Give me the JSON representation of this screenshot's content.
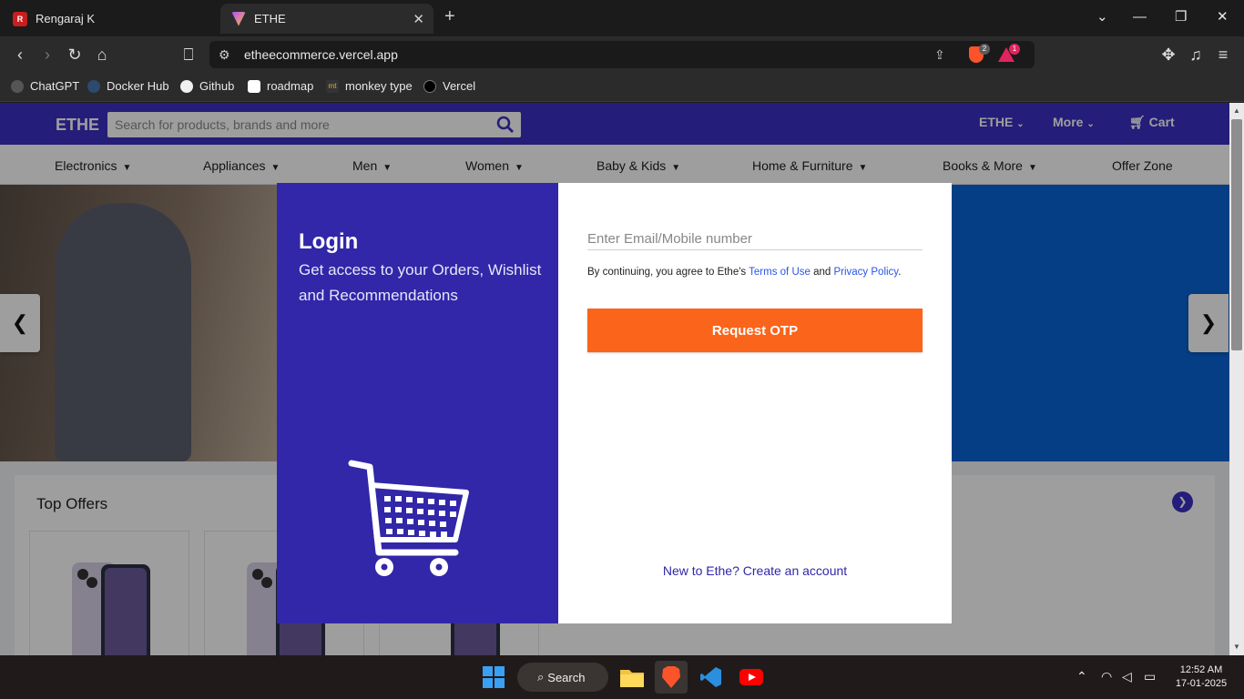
{
  "browser": {
    "tabs": [
      {
        "title": "Rengaraj K",
        "favicon": "R"
      },
      {
        "title": "ETHE"
      }
    ],
    "url": "etheecommerce.vercel.app",
    "shield_count": "2",
    "rewards_count": "1",
    "bookmarks": [
      {
        "label": "ChatGPT"
      },
      {
        "label": "Docker Hub"
      },
      {
        "label": "Github"
      },
      {
        "label": "roadmap"
      },
      {
        "label": "monkey type",
        "icon_text": "mt"
      },
      {
        "label": "Vercel"
      }
    ]
  },
  "site": {
    "logo": "ETHE",
    "search_placeholder": "Search for products, brands and more",
    "header_links": {
      "account": "ETHE",
      "more": "More",
      "cart": "Cart"
    },
    "categories": [
      "Electronics",
      "Appliances",
      "Men",
      "Women",
      "Baby & Kids",
      "Home & Furniture",
      "Books & More",
      "Offer Zone"
    ],
    "top_offers_title": "Top Offers"
  },
  "login_modal": {
    "title": "Login",
    "subtitle": "Get access to your Orders, Wishlist and Recommendations",
    "email_placeholder": "Enter Email/Mobile number",
    "terms_prefix": "By continuing, you agree to Ethe's ",
    "terms_link": "Terms of Use",
    "terms_and": " and ",
    "privacy_link": "Privacy Policy",
    "terms_suffix": ".",
    "otp_button": "Request OTP",
    "signup_link": "New to Ethe? Create an account",
    "close_icon": "×"
  },
  "taskbar": {
    "search_label": "Search",
    "time": "12:52 AM",
    "date": "17-01-2025"
  },
  "colors": {
    "brand": "#3b30c4",
    "modal_left": "#3127a8",
    "otp_button": "#fb641b",
    "hero_blue": "#0a64d8"
  }
}
